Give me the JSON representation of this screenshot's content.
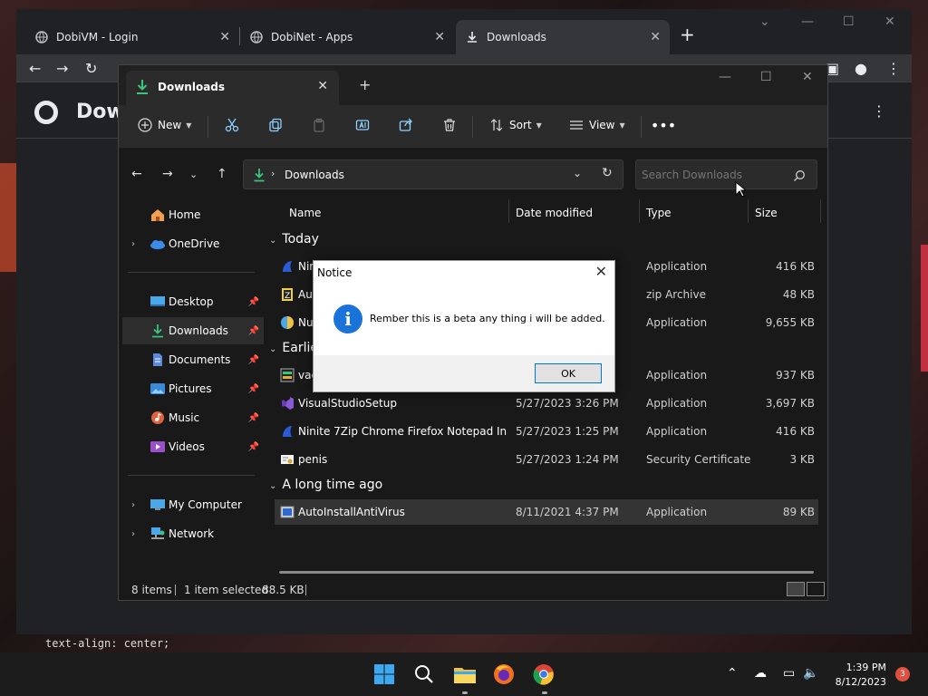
{
  "chrome": {
    "tabs": [
      {
        "label": "DobiVM - Login"
      },
      {
        "label": "DobiNet - Apps"
      },
      {
        "label": "Downloads"
      }
    ],
    "page_title": "Dow",
    "code_peek": "text-align: center;"
  },
  "explorer": {
    "tab_label": "Downloads",
    "commands": {
      "new": "New",
      "sort": "Sort",
      "view": "View"
    },
    "address": {
      "path": "Downloads"
    },
    "search": {
      "placeholder": "Search Downloads"
    },
    "nav": [
      {
        "label": "Home"
      },
      {
        "label": "OneDrive"
      },
      {
        "label": "Desktop"
      },
      {
        "label": "Downloads"
      },
      {
        "label": "Documents"
      },
      {
        "label": "Pictures"
      },
      {
        "label": "Music"
      },
      {
        "label": "Videos"
      },
      {
        "label": "My Computer"
      },
      {
        "label": "Network"
      }
    ],
    "columns": {
      "name": "Name",
      "date": "Date modified",
      "type": "Type",
      "size": "Size"
    },
    "groups": {
      "today": "Today",
      "earlier": "Earlie",
      "longago": "A long time ago"
    },
    "files": [
      {
        "name": "Nini",
        "date": "",
        "type": "Application",
        "size": "416 KB"
      },
      {
        "name": "Auto",
        "date": "",
        "type": "zip Archive",
        "size": "48 KB"
      },
      {
        "name": "Nu",
        "date": "",
        "type": "Application",
        "size": "9,655 KB"
      },
      {
        "name": "vac",
        "date": "",
        "type": "Application",
        "size": "937 KB"
      },
      {
        "name": "VisualStudioSetup",
        "date": "5/27/2023 3:26 PM",
        "type": "Application",
        "size": "3,697 KB"
      },
      {
        "name": "Ninite 7Zip Chrome Firefox Notepad Inst...",
        "date": "5/27/2023 1:25 PM",
        "type": "Application",
        "size": "416 KB"
      },
      {
        "name": "penis",
        "date": "5/27/2023 1:24 PM",
        "type": "Security Certificate",
        "size": "3 KB"
      },
      {
        "name": "AutoInstallAntiVirus",
        "date": "8/11/2021 4:37 PM",
        "type": "Application",
        "size": "89 KB"
      }
    ],
    "status": {
      "items": "8 items",
      "selected": "1 item selected",
      "size": "88.5 KB"
    }
  },
  "notice": {
    "title": "Notice",
    "message": "Rember this is a beta any thing i will be added.",
    "ok_label": "OK",
    "icon_glyph": "i"
  },
  "taskbar": {
    "time": "1:39 PM",
    "date": "8/12/2023",
    "badge": "3"
  },
  "colors": {
    "accent_download": "#3cc47c",
    "dialog_info": "#1a73d9"
  }
}
